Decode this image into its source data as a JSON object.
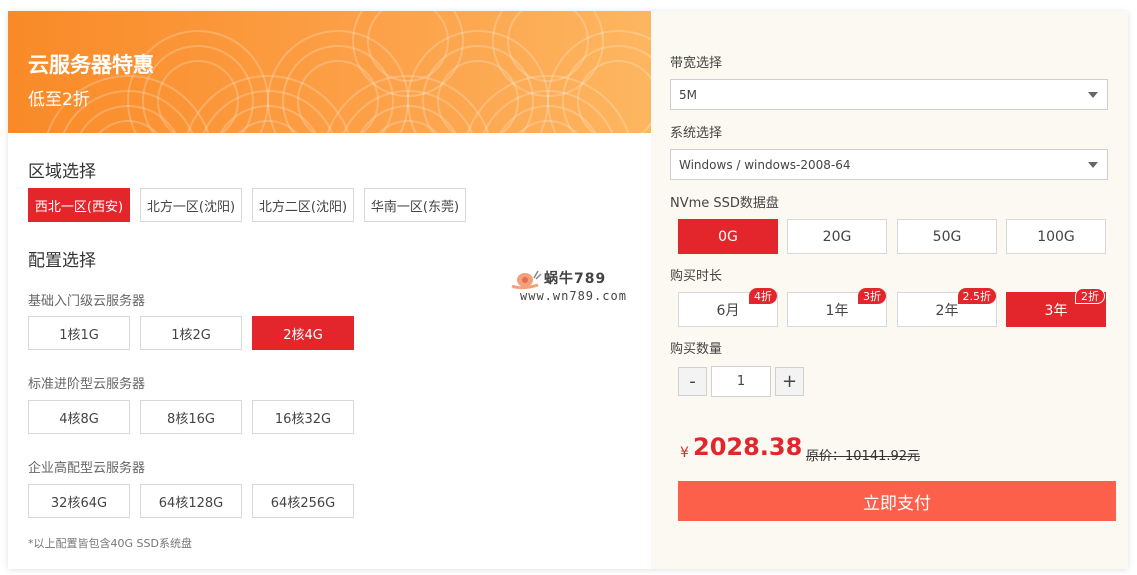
{
  "banner": {
    "title": "云服务器特惠",
    "subtitle": "低至2折"
  },
  "region": {
    "title": "区域选择",
    "options": [
      "西北一区(西安)",
      "北方一区(沈阳)",
      "北方二区(沈阳)",
      "华南一区(东莞)"
    ],
    "selected_index": 0
  },
  "config": {
    "title": "配置选择",
    "groups": [
      {
        "name": "基础入门级云服务器",
        "options": [
          "1核1G",
          "1核2G",
          "2核4G"
        ],
        "selected_index": 2
      },
      {
        "name": "标准进阶型云服务器",
        "options": [
          "4核8G",
          "8核16G",
          "16核32G"
        ],
        "selected_index": -1
      },
      {
        "name": "企业高配型云服务器",
        "options": [
          "32核64G",
          "64核128G",
          "64核256G"
        ],
        "selected_index": -1
      }
    ],
    "note": "*以上配置皆包含40G SSD系统盘"
  },
  "watermark": {
    "title": "蜗牛789",
    "url": "www.wn789.com"
  },
  "bandwidth": {
    "label": "带宽选择",
    "value": "5M"
  },
  "system": {
    "label": "系统选择",
    "value": "Windows / windows-2008-64"
  },
  "disk": {
    "label": "NVme SSD数据盘",
    "options": [
      "0G",
      "20G",
      "50G",
      "100G"
    ],
    "selected_index": 0
  },
  "duration": {
    "label": "购买时长",
    "options": [
      {
        "label": "6月",
        "badge": "4折"
      },
      {
        "label": "1年",
        "badge": "3折"
      },
      {
        "label": "2年",
        "badge": "2.5折"
      },
      {
        "label": "3年",
        "badge": "2折"
      }
    ],
    "selected_index": 3
  },
  "quantity": {
    "label": "购买数量",
    "minus": "-",
    "plus": "+",
    "value": "1"
  },
  "price": {
    "currency": "¥",
    "amount": "2028.38",
    "original": "原价：10141.92元"
  },
  "pay_button": "立即支付",
  "colors": {
    "accent": "#e2262b",
    "pay": "#fc5f4a",
    "banner_start": "#f98a27",
    "banner_end": "#fdb660"
  }
}
